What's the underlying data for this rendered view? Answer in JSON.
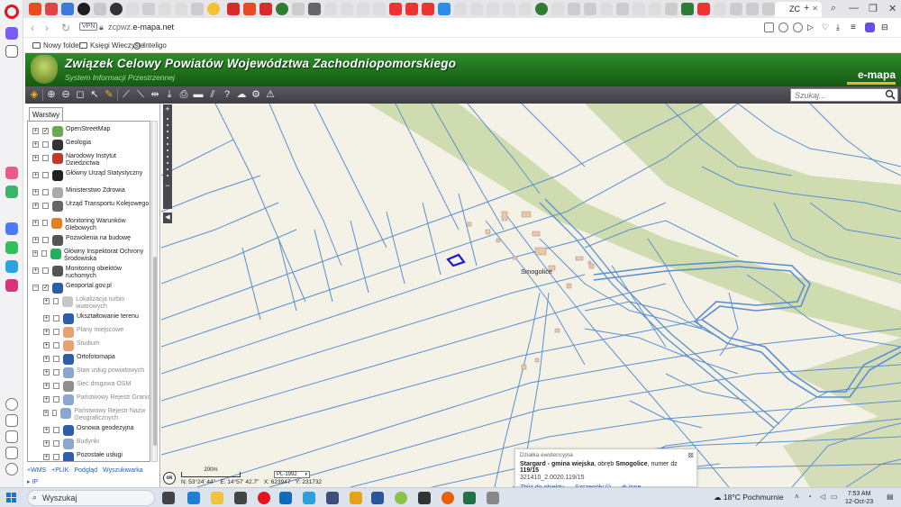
{
  "browser": {
    "active_tab_label": "ZC",
    "url_host": "zcpwz.",
    "url_domain": "e-mapa.net",
    "vpn_label": "VPN",
    "bookmarks": [
      {
        "label": "Nowy folder"
      },
      {
        "label": "Księgi Wieczyste"
      },
      {
        "label": "Inteligo"
      }
    ]
  },
  "site": {
    "title": "Związek Celowy Powiatów Województwa Zachodniopomorskiego",
    "subtitle": "System Informacji Przestrzennej",
    "brand": "e-mapa"
  },
  "toolbar": {
    "search_placeholder": "Szukaj..."
  },
  "layers_panel": {
    "tab_label": "Warstwy",
    "layers": [
      {
        "label": "OpenStreetMap",
        "checked": true,
        "dim": false,
        "indent": 0,
        "icon": "osm-icon",
        "expand": "+"
      },
      {
        "label": "Geologia",
        "checked": false,
        "dim": false,
        "indent": 0,
        "icon": "hammer-pick-icon",
        "expand": "+"
      },
      {
        "label": "Narodowy Instytut Dziedzictwa",
        "checked": false,
        "dim": false,
        "indent": 0,
        "icon": "heritage-icon",
        "expand": "+"
      },
      {
        "label": "Główny Urząd Statystyczny",
        "checked": false,
        "dim": false,
        "indent": 0,
        "icon": "statistics-icon",
        "expand": "+"
      },
      {
        "label": "Ministerstwo Zdrowia",
        "checked": false,
        "dim": false,
        "indent": 0,
        "icon": "health-icon",
        "expand": "+"
      },
      {
        "label": "Urząd Transportu Kolejowego",
        "checked": false,
        "dim": false,
        "indent": 0,
        "icon": "railway-icon",
        "expand": "+"
      },
      {
        "label": "Monitoring Warunków Glebowych",
        "checked": false,
        "dim": false,
        "indent": 0,
        "icon": "soil-icon",
        "expand": "+"
      },
      {
        "label": "Pozwolenia na budowę",
        "checked": false,
        "dim": false,
        "indent": 0,
        "icon": "building-permit-icon",
        "expand": "+"
      },
      {
        "label": "Główny Inspektorat Ochrony Środowiska",
        "checked": false,
        "dim": false,
        "indent": 0,
        "icon": "environment-icon",
        "expand": "+"
      },
      {
        "label": "Monitoring obiektów ruchomych",
        "checked": false,
        "dim": false,
        "indent": 0,
        "icon": "moving-objects-icon",
        "expand": "+"
      },
      {
        "label": "Geoportal.gov.pl",
        "checked": true,
        "dim": false,
        "indent": 0,
        "icon": "geoportal-icon",
        "expand": "−"
      },
      {
        "label": "Lokalizacja turbin wiatrowych",
        "checked": false,
        "dim": true,
        "indent": 1,
        "icon": "wind-turbine-icon",
        "expand": "+"
      },
      {
        "label": "Ukształtowanie terenu",
        "checked": false,
        "dim": false,
        "indent": 1,
        "icon": "geoportal-icon",
        "expand": "+"
      },
      {
        "label": "Plany miejscowe",
        "checked": false,
        "dim": true,
        "indent": 1,
        "icon": "local-plans-icon",
        "expand": "+"
      },
      {
        "label": "Studium",
        "checked": false,
        "dim": true,
        "indent": 1,
        "icon": "study-icon",
        "expand": "+"
      },
      {
        "label": "Ortofotomapa",
        "checked": false,
        "dim": false,
        "indent": 1,
        "icon": "geoportal-icon",
        "expand": "+"
      },
      {
        "label": "Stan usług powiatowych",
        "checked": false,
        "dim": true,
        "indent": 1,
        "icon": "geoportal-icon",
        "expand": "+"
      },
      {
        "label": "Sieć drogowa OSM",
        "checked": false,
        "dim": true,
        "indent": 1,
        "icon": "road-network-icon",
        "expand": "+"
      },
      {
        "label": "Państwowy Rejestr Granic",
        "checked": false,
        "dim": true,
        "indent": 1,
        "icon": "geoportal-icon",
        "expand": "+"
      },
      {
        "label": "Państwowy Rejestr Nazw Geograficznych",
        "checked": false,
        "dim": true,
        "indent": 1,
        "icon": "geoportal-icon",
        "expand": "+"
      },
      {
        "label": "Osnowa geodezyjna",
        "checked": false,
        "dim": false,
        "indent": 1,
        "icon": "geoportal-icon",
        "expand": "+"
      },
      {
        "label": "Budynki",
        "checked": false,
        "dim": true,
        "indent": 1,
        "icon": "geoportal-icon",
        "expand": "+"
      },
      {
        "label": "Pozostałe usługi",
        "checked": false,
        "dim": false,
        "indent": 1,
        "icon": "geoportal-icon",
        "expand": "+"
      }
    ],
    "footer_links": [
      "+WMS",
      "+PLIK",
      "Podgląd",
      "Wyszukiwarka"
    ],
    "footer_ip": "IP"
  },
  "map": {
    "place_label": "Smogolice",
    "colors": {
      "parcel_line": "#5b8fd0",
      "field": "#f4f2e6",
      "meadow": "#cfdcb0",
      "selected": "#1a1ad8",
      "building": "#e8c8a8"
    }
  },
  "status": {
    "ok_label": "ok",
    "scale_label": "200m",
    "crs": "PL-1992",
    "n": "N: 53°24' 44\"",
    "e": "E: 14°57' 42.7\"",
    "x": "X: 623947",
    "y": "Y: 231732"
  },
  "info_popup": {
    "header": "Działka ewidencyjna",
    "main_bold": "Stargard - gmina wiejska",
    "main_rest": ", obręb ",
    "main_bold2": "Smogolice",
    "main_rest2": ", numer dz ",
    "main_bold3": "119/15",
    "identifier": "321410_2.0020.119/15",
    "links": [
      "Zbliż do obiektu",
      "Szczegóły (i)",
      "Inne"
    ]
  },
  "taskbar": {
    "search_label": "Wyszukaj",
    "weather": "18°C  Pochmurnie",
    "time": "7:53 AM",
    "date": "12-Oct-23"
  }
}
